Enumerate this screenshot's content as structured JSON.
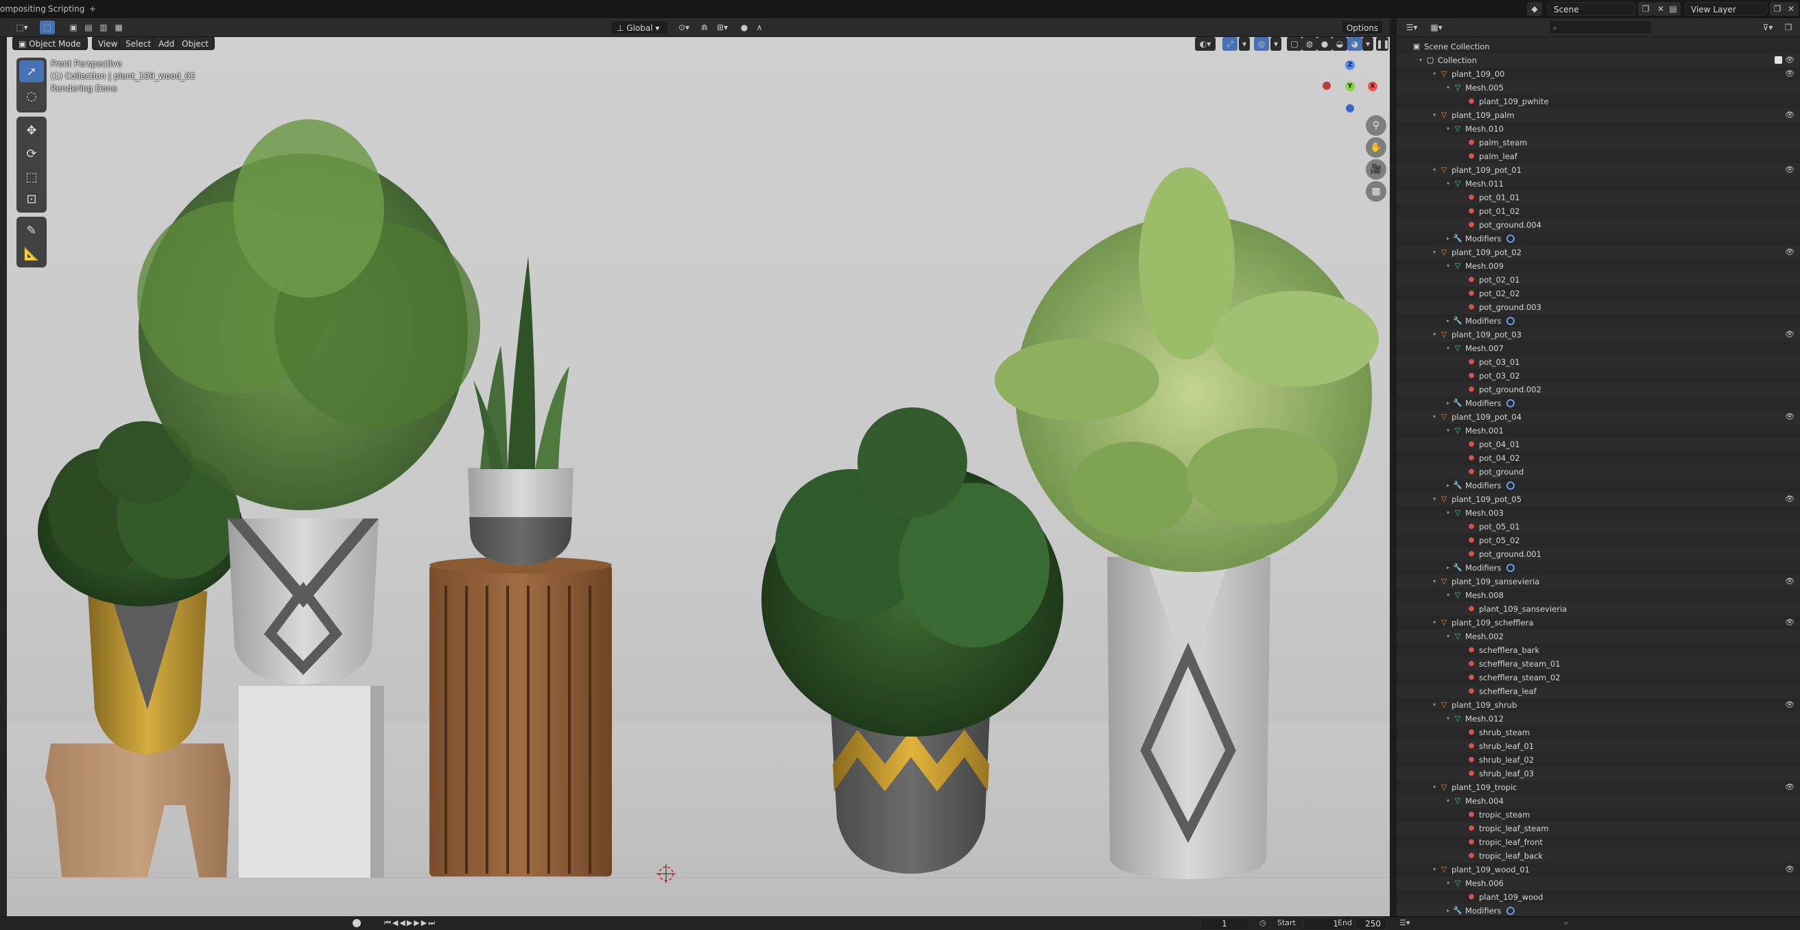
{
  "workspace_tabs": [
    "ompositing",
    "Scripting",
    "+"
  ],
  "header": {
    "orientation": "Global",
    "options": "Options",
    "scene": "Scene",
    "view_layer": "View Layer"
  },
  "viewport": {
    "mode": "Object Mode",
    "menus": [
      "View",
      "Select",
      "Add",
      "Object"
    ],
    "info_line1": "Front Perspective",
    "info_line2": "(1) Collection | plant_109_wood_02",
    "info_line3": "Rendering Done",
    "gizmo": {
      "z": "Z",
      "y": "Y",
      "x": "X"
    }
  },
  "outliner": {
    "search_placeholder": "",
    "rows": [
      {
        "label": "Scene Collection",
        "type": "scene",
        "depth": 0,
        "arrow": ""
      },
      {
        "label": "Collection",
        "type": "collection",
        "depth": 1,
        "arrow": "▾",
        "check": true
      },
      {
        "label": "plant_109_00",
        "type": "object",
        "depth": 2,
        "arrow": "▾",
        "eye": true
      },
      {
        "label": "Mesh.005",
        "type": "mesh",
        "depth": 3,
        "arrow": "▾"
      },
      {
        "label": "plant_109_pwhite",
        "type": "material",
        "depth": 4,
        "arrow": ""
      },
      {
        "label": "plant_109_palm",
        "type": "object",
        "depth": 2,
        "arrow": "▾",
        "eye": true
      },
      {
        "label": "Mesh.010",
        "type": "mesh",
        "depth": 3,
        "arrow": "▾"
      },
      {
        "label": "palm_steam",
        "type": "material",
        "depth": 4,
        "arrow": ""
      },
      {
        "label": "palm_leaf",
        "type": "material",
        "depth": 4,
        "arrow": ""
      },
      {
        "label": "plant_109_pot_01",
        "type": "object",
        "depth": 2,
        "arrow": "▾",
        "eye": true
      },
      {
        "label": "Mesh.011",
        "type": "mesh",
        "depth": 3,
        "arrow": "▾"
      },
      {
        "label": "pot_01_01",
        "type": "material",
        "depth": 4,
        "arrow": ""
      },
      {
        "label": "pot_01_02",
        "type": "material",
        "depth": 4,
        "arrow": ""
      },
      {
        "label": "pot_ground.004",
        "type": "material",
        "depth": 4,
        "arrow": ""
      },
      {
        "label": "Modifiers",
        "type": "modifier",
        "depth": 3,
        "arrow": "▸"
      },
      {
        "label": "plant_109_pot_02",
        "type": "object",
        "depth": 2,
        "arrow": "▾",
        "eye": true
      },
      {
        "label": "Mesh.009",
        "type": "mesh",
        "depth": 3,
        "arrow": "▾"
      },
      {
        "label": "pot_02_01",
        "type": "material",
        "depth": 4,
        "arrow": ""
      },
      {
        "label": "pot_02_02",
        "type": "material",
        "depth": 4,
        "arrow": ""
      },
      {
        "label": "pot_ground.003",
        "type": "material",
        "depth": 4,
        "arrow": ""
      },
      {
        "label": "Modifiers",
        "type": "modifier",
        "depth": 3,
        "arrow": "▸"
      },
      {
        "label": "plant_109_pot_03",
        "type": "object",
        "depth": 2,
        "arrow": "▾",
        "eye": true
      },
      {
        "label": "Mesh.007",
        "type": "mesh",
        "depth": 3,
        "arrow": "▾"
      },
      {
        "label": "pot_03_01",
        "type": "material",
        "depth": 4,
        "arrow": ""
      },
      {
        "label": "pot_03_02",
        "type": "material",
        "depth": 4,
        "arrow": ""
      },
      {
        "label": "pot_ground.002",
        "type": "material",
        "depth": 4,
        "arrow": ""
      },
      {
        "label": "Modifiers",
        "type": "modifier",
        "depth": 3,
        "arrow": "▸"
      },
      {
        "label": "plant_109_pot_04",
        "type": "object",
        "depth": 2,
        "arrow": "▾",
        "eye": true
      },
      {
        "label": "Mesh.001",
        "type": "mesh",
        "depth": 3,
        "arrow": "▾"
      },
      {
        "label": "pot_04_01",
        "type": "material",
        "depth": 4,
        "arrow": ""
      },
      {
        "label": "pot_04_02",
        "type": "material",
        "depth": 4,
        "arrow": ""
      },
      {
        "label": "pot_ground",
        "type": "material",
        "depth": 4,
        "arrow": ""
      },
      {
        "label": "Modifiers",
        "type": "modifier",
        "depth": 3,
        "arrow": "▸"
      },
      {
        "label": "plant_109_pot_05",
        "type": "object",
        "depth": 2,
        "arrow": "▾",
        "eye": true
      },
      {
        "label": "Mesh.003",
        "type": "mesh",
        "depth": 3,
        "arrow": "▾"
      },
      {
        "label": "pot_05_01",
        "type": "material",
        "depth": 4,
        "arrow": ""
      },
      {
        "label": "pot_05_02",
        "type": "material",
        "depth": 4,
        "arrow": ""
      },
      {
        "label": "pot_ground.001",
        "type": "material",
        "depth": 4,
        "arrow": ""
      },
      {
        "label": "Modifiers",
        "type": "modifier",
        "depth": 3,
        "arrow": "▸"
      },
      {
        "label": "plant_109_sansevieria",
        "type": "object",
        "depth": 2,
        "arrow": "▾",
        "eye": true
      },
      {
        "label": "Mesh.008",
        "type": "mesh",
        "depth": 3,
        "arrow": "▾"
      },
      {
        "label": "plant_109_sansevieria",
        "type": "material",
        "depth": 4,
        "arrow": ""
      },
      {
        "label": "plant_109_schefflera",
        "type": "object",
        "depth": 2,
        "arrow": "▾",
        "eye": true
      },
      {
        "label": "Mesh.002",
        "type": "mesh",
        "depth": 3,
        "arrow": "▾"
      },
      {
        "label": "schefflera_bark",
        "type": "material",
        "depth": 4,
        "arrow": ""
      },
      {
        "label": "schefflera_steam_01",
        "type": "material",
        "depth": 4,
        "arrow": ""
      },
      {
        "label": "schefflera_steam_02",
        "type": "material",
        "depth": 4,
        "arrow": ""
      },
      {
        "label": "schefflera_leaf",
        "type": "material",
        "depth": 4,
        "arrow": ""
      },
      {
        "label": "plant_109_shrub",
        "type": "object",
        "depth": 2,
        "arrow": "▾",
        "eye": true
      },
      {
        "label": "Mesh.012",
        "type": "mesh",
        "depth": 3,
        "arrow": "▾"
      },
      {
        "label": "shrub_steam",
        "type": "material",
        "depth": 4,
        "arrow": ""
      },
      {
        "label": "shrub_leaf_01",
        "type": "material",
        "depth": 4,
        "arrow": ""
      },
      {
        "label": "shrub_leaf_02",
        "type": "material",
        "depth": 4,
        "arrow": ""
      },
      {
        "label": "shrub_leaf_03",
        "type": "material",
        "depth": 4,
        "arrow": ""
      },
      {
        "label": "plant_109_tropic",
        "type": "object",
        "depth": 2,
        "arrow": "▾",
        "eye": true
      },
      {
        "label": "Mesh.004",
        "type": "mesh",
        "depth": 3,
        "arrow": "▾"
      },
      {
        "label": "tropic_steam",
        "type": "material",
        "depth": 4,
        "arrow": ""
      },
      {
        "label": "tropic_leaf_steam",
        "type": "material",
        "depth": 4,
        "arrow": ""
      },
      {
        "label": "tropic_leaf_front",
        "type": "material",
        "depth": 4,
        "arrow": ""
      },
      {
        "label": "tropic_leaf_back",
        "type": "material",
        "depth": 4,
        "arrow": ""
      },
      {
        "label": "plant_109_wood_01",
        "type": "object",
        "depth": 2,
        "arrow": "▾",
        "eye": true
      },
      {
        "label": "Mesh.006",
        "type": "mesh",
        "depth": 3,
        "arrow": "▾"
      },
      {
        "label": "plant_109_wood",
        "type": "material",
        "depth": 4,
        "arrow": ""
      },
      {
        "label": "Modifiers",
        "type": "modifier",
        "depth": 3,
        "arrow": "▸"
      }
    ]
  },
  "timeline": {
    "current_frame": "1",
    "start_label": "Start",
    "start": "1",
    "end_label": "End",
    "end": "250"
  },
  "colors": {
    "accent": "#4772b3",
    "object_icon": "#e8873a",
    "mesh_icon": "#3fcf8e",
    "material_icon": "#d9534f",
    "modifier_icon": "#6e9be8"
  }
}
